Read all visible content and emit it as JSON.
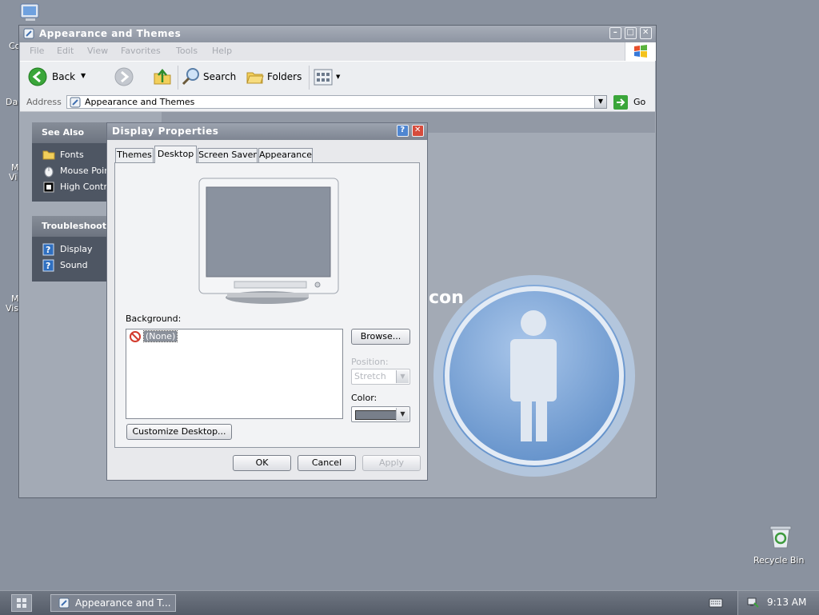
{
  "desktop": {
    "icon_labels": [
      "Co",
      "Da",
      "M",
      "Vi",
      "M",
      "Vis"
    ],
    "recycle_bin": "Recycle Bin",
    "background_word": "con"
  },
  "explorer": {
    "title": "Appearance and Themes",
    "menu": [
      "File",
      "Edit",
      "View",
      "Favorites",
      "Tools",
      "Help"
    ],
    "toolbar": {
      "back": "Back",
      "search": "Search",
      "folders": "Folders"
    },
    "address_label": "Address",
    "address_value": "Appearance and Themes",
    "go": "Go",
    "see_also": {
      "title": "See Also",
      "items": [
        "Fonts",
        "Mouse Point",
        "High Contra"
      ]
    },
    "troubleshooters": {
      "title": "Troubleshoote",
      "items": [
        "Display",
        "Sound"
      ]
    }
  },
  "dialog": {
    "title": "Display Properties",
    "tabs": [
      "Themes",
      "Desktop",
      "Screen Saver",
      "Appearance"
    ],
    "active_tab": "Desktop",
    "background_label": "Background:",
    "background_items": [
      "(None)"
    ],
    "browse": "Browse...",
    "position_label": "Position:",
    "position_value": "Stretch",
    "color_label": "Color:",
    "color_value": "#787f8a",
    "customize": "Customize Desktop...",
    "ok": "OK",
    "cancel": "Cancel",
    "apply": "Apply"
  },
  "taskbar": {
    "task_title": "Appearance and T...",
    "clock": "9:13 AM"
  }
}
